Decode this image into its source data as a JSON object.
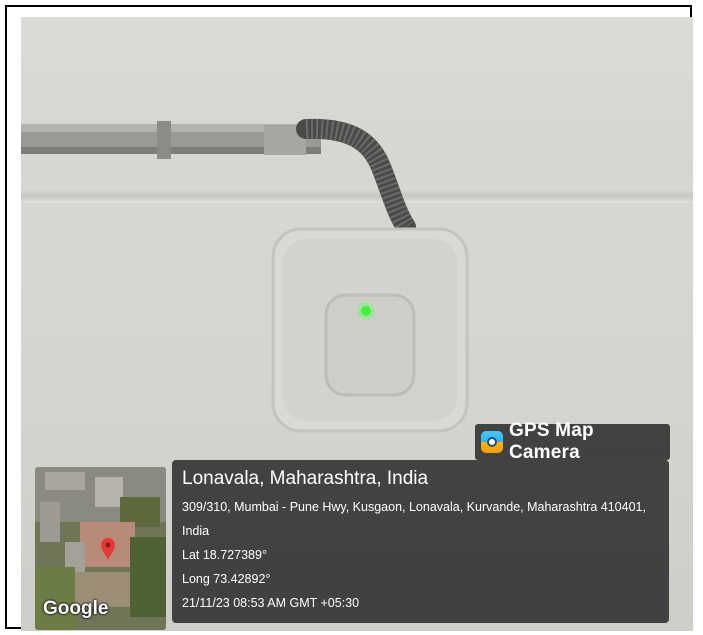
{
  "photo": {
    "subject": "ceiling-mounted wireless access point with green status light"
  },
  "badge": {
    "label": "GPS Map Camera",
    "icon": "gps-map-camera-icon"
  },
  "location": {
    "place": "Lonavala, Maharashtra, India",
    "address": "309/310, Mumbai - Pune Hwy, Kusgaon, Lonavala, Kurvande, Maharashtra 410401, India",
    "lat": "Lat 18.727389°",
    "long": "Long 73.42892°",
    "timestamp": "21/11/23 08:53 AM GMT +05:30"
  },
  "map": {
    "logo": "Google",
    "pin_color": "#e53935"
  }
}
